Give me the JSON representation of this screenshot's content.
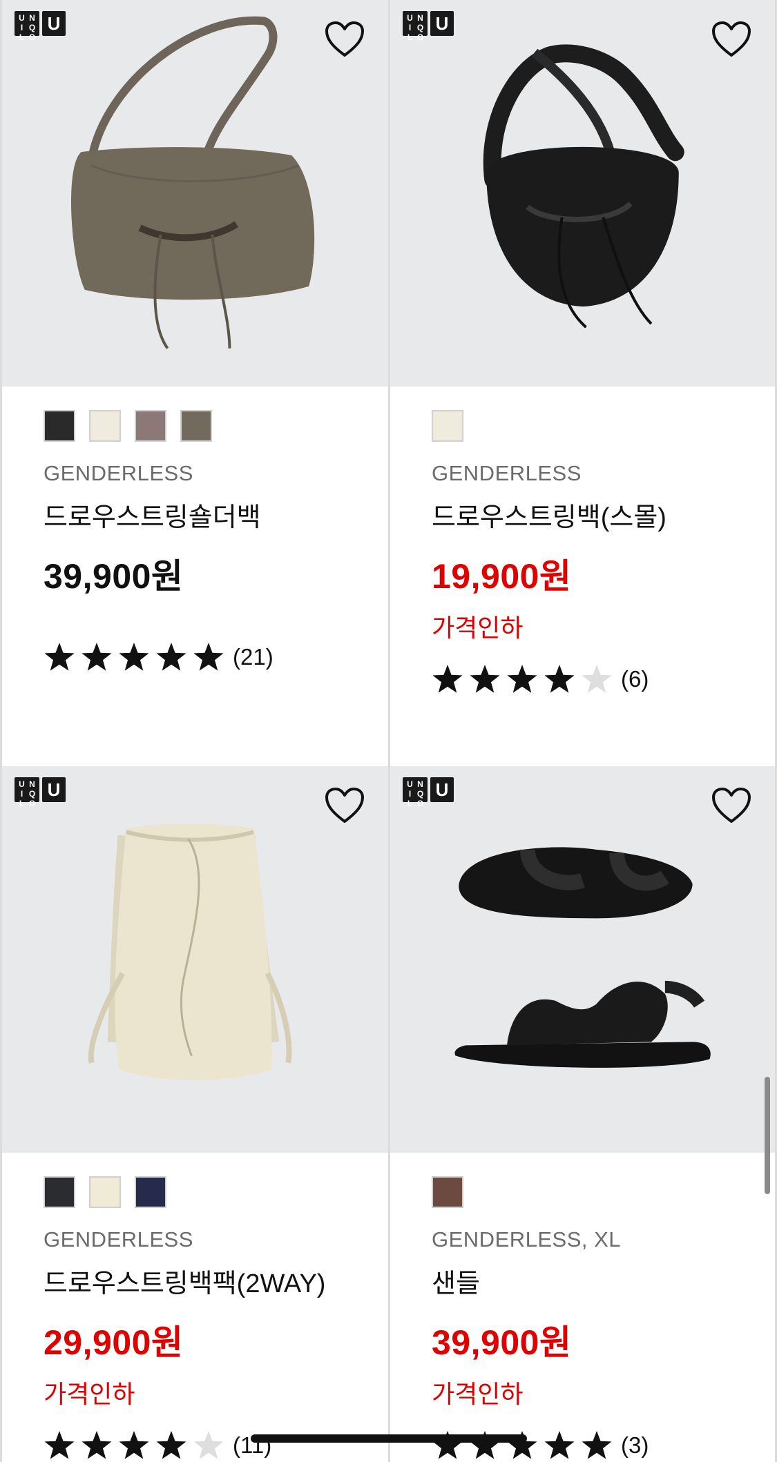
{
  "brand": {
    "uq_letters": [
      "U",
      "N",
      "I",
      "Q",
      "L",
      "O"
    ],
    "u_letter": "U"
  },
  "products": [
    {
      "swatches": [
        "#2a2a2a",
        "#efebdd",
        "#8c7876",
        "#736a5e"
      ],
      "tag": "GENDERLESS",
      "name": "드로우스트링숄더백",
      "price": "39,900원",
      "price_sale": false,
      "badge": "",
      "rating": 5,
      "review_count": "(21)"
    },
    {
      "swatches": [
        "#efebdd"
      ],
      "tag": "GENDERLESS",
      "name": "드로우스트링백(스몰)",
      "price": "19,900원",
      "price_sale": true,
      "badge": "가격인하",
      "rating": 4,
      "review_count": "(6)"
    },
    {
      "swatches": [
        "#2a2c30",
        "#efebd6",
        "#262b4c"
      ],
      "tag": "GENDERLESS",
      "name": "드로우스트링백팩(2WAY)",
      "price": "29,900원",
      "price_sale": true,
      "badge": "가격인하",
      "rating": 4,
      "review_count": "(11)"
    },
    {
      "swatches": [
        "#6b4a40"
      ],
      "tag": "GENDERLESS, XL",
      "name": "샌들",
      "price": "39,900원",
      "price_sale": true,
      "badge": "가격인하",
      "rating": 5,
      "review_count": "(3)"
    }
  ],
  "icons": {
    "favorite": "heart-outline-icon",
    "star": "star-icon"
  },
  "colors": {
    "sale": "#e00000",
    "star_filled": "#111111",
    "star_empty": "#dedede",
    "image_bg": "#e8e9eb"
  }
}
